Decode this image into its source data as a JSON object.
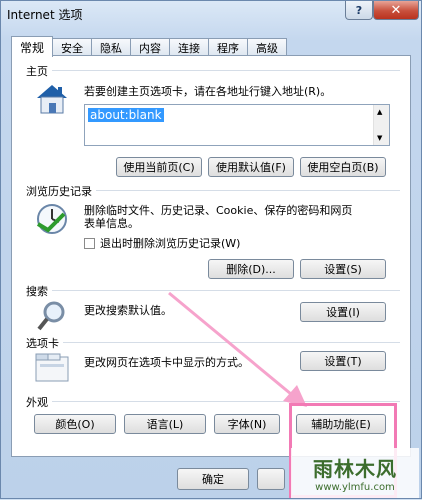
{
  "window": {
    "title": "Internet 选项"
  },
  "tabs": [
    "常规",
    "安全",
    "隐私",
    "内容",
    "连接",
    "程序",
    "高级"
  ],
  "home": {
    "label": "主页",
    "desc": "若要创建主页选项卡，请在各地址行键入地址(R)。",
    "value": "about:blank",
    "btn_current": "使用当前页(C)",
    "btn_default": "使用默认值(F)",
    "btn_blank": "使用空白页(B)"
  },
  "history": {
    "label": "浏览历史记录",
    "desc1": "删除临时文件、历史记录、Cookie、保存的密码和网页",
    "desc2": "表单信息。",
    "checkbox": "退出时删除浏览历史记录(W)",
    "btn_delete": "删除(D)...",
    "btn_settings": "设置(S)"
  },
  "search": {
    "label": "搜索",
    "desc": "更改搜索默认值。",
    "btn_settings": "设置(I)"
  },
  "tabs_section": {
    "label": "选项卡",
    "desc": "更改网页在选项卡中显示的方式。",
    "btn_settings": "设置(T)"
  },
  "appearance": {
    "label": "外观",
    "btn_colors": "颜色(O)",
    "btn_languages": "语言(L)",
    "btn_fonts": "字体(N)",
    "btn_accessibility": "辅助功能(E)"
  },
  "footer": {
    "ok": "确定"
  },
  "watermark": {
    "main": "雨林木风",
    "sub": "www.ylmfu.com"
  },
  "colors": {
    "highlight": "#f27ab5",
    "selection": "#3399ff"
  }
}
